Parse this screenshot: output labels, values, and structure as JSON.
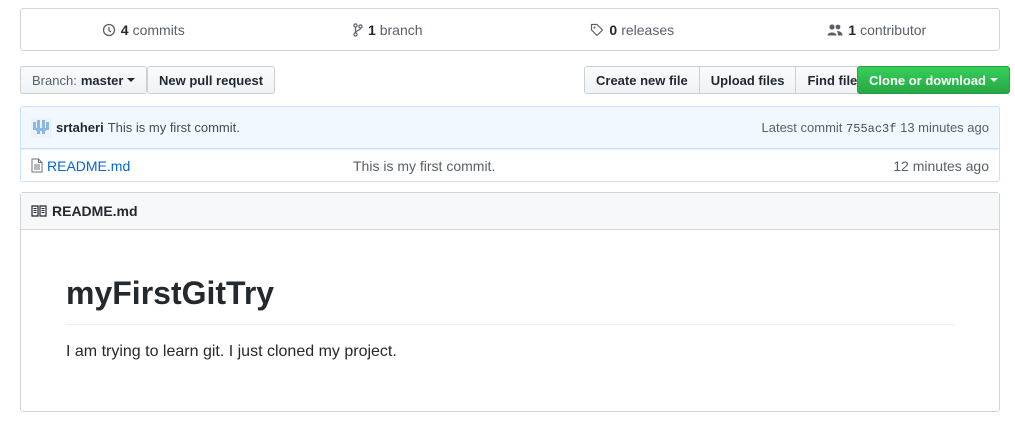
{
  "stats": [
    {
      "icon": "commits-icon",
      "count": "4",
      "label": "commits"
    },
    {
      "icon": "branch-icon",
      "count": "1",
      "label": "branch"
    },
    {
      "icon": "tag-icon",
      "count": "0",
      "label": "releases"
    },
    {
      "icon": "people-icon",
      "count": "1",
      "label": "contributor"
    }
  ],
  "toolbar": {
    "branch_prefix": "Branch:",
    "branch_name": "master",
    "new_pr": "New pull request",
    "create_file": "Create new file",
    "upload_files": "Upload files",
    "find_file": "Find file",
    "clone": "Clone or download"
  },
  "commit": {
    "author": "srtaheri",
    "message": "This is my first commit.",
    "latest_label": "Latest commit",
    "sha": "755ac3f",
    "age": "13 minutes ago"
  },
  "files": [
    {
      "icon": "file-icon",
      "name": "README.md",
      "message": "This is my first commit.",
      "age": "12 minutes ago"
    }
  ],
  "readme": {
    "filename": "README.md",
    "heading": "myFirstGitTry",
    "paragraph": "I am trying to learn git. I just cloned my project."
  },
  "colors": {
    "accent": "#0366d6",
    "green": "#28a745",
    "commit_bg": "#f1f8ff"
  }
}
